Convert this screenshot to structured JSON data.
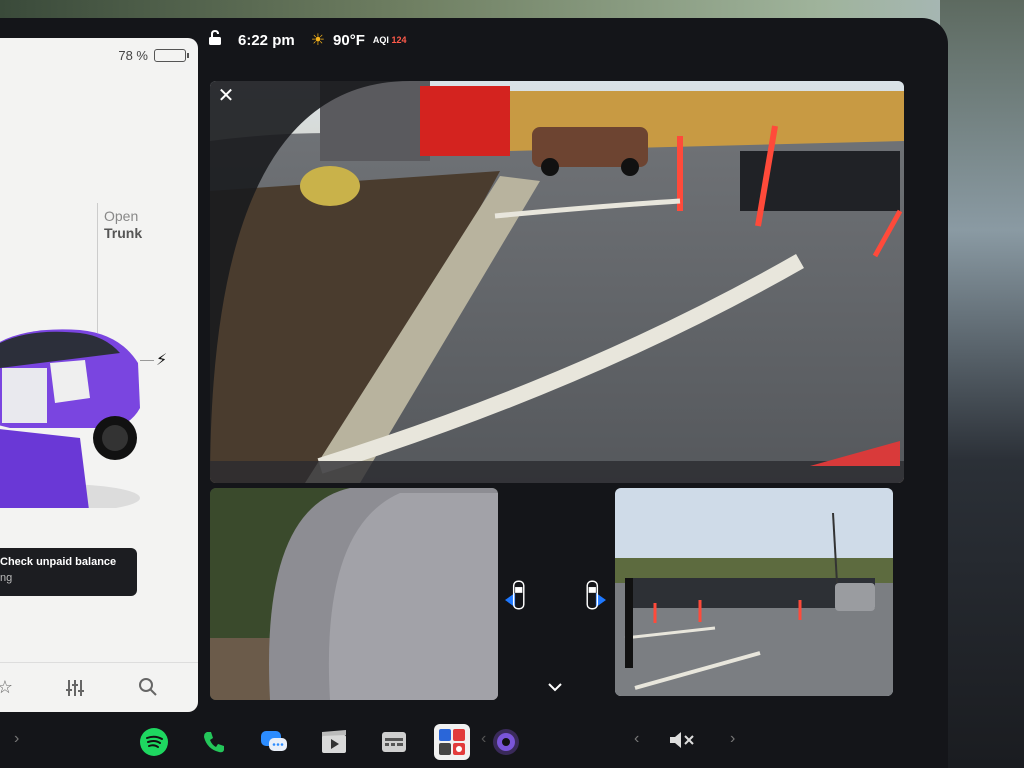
{
  "card": {
    "battery_percent": "78 %",
    "battery_level": 0.78,
    "trunk_line1": "Open",
    "trunk_line2": "Trunk",
    "toast_title": "Check unpaid balance",
    "toast_sub": "ng",
    "bar_icons": [
      "star-icon",
      "controls-sliders-icon",
      "search-icon"
    ]
  },
  "status": {
    "time": "6:22 pm",
    "temperature": "90°F",
    "aqi_label": "AQI",
    "aqi_value": "124",
    "icons": [
      "lock-open-icon",
      "sun-icon"
    ]
  },
  "camera": {
    "views": [
      "rear-camera",
      "left-repeater-camera",
      "right-repeater-camera"
    ],
    "close_icon": "close-icon",
    "expand_icon": "chevron-down-icon"
  },
  "dock": {
    "apps": [
      "spotify-icon",
      "phone-icon",
      "messages-icon",
      "theater-icon",
      "toybox-icon",
      "app-launcher-icon",
      "camera-icon"
    ],
    "volume": "mute-icon"
  },
  "colors": {
    "card_bg": "#f3f3f2",
    "car_paint": "#7a45e0",
    "accent_blue": "#1e78ff",
    "aqi_red": "#ff5a4a",
    "spotify_green": "#1ed760",
    "phone_green": "#24c65a"
  }
}
